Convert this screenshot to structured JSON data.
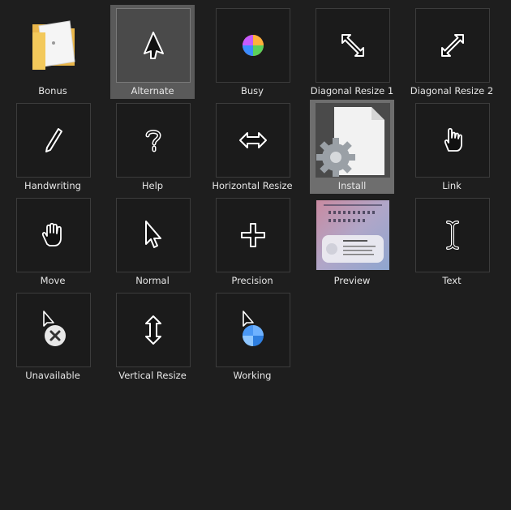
{
  "items": [
    {
      "label": "Bonus",
      "icon": "folder-icon"
    },
    {
      "label": "Alternate",
      "icon": "alternate-cursor-icon"
    },
    {
      "label": "Busy",
      "icon": "busy-cursor-icon"
    },
    {
      "label": "Diagonal Resize 1",
      "icon": "diagonal-resize-1-icon"
    },
    {
      "label": "Diagonal Resize 2",
      "icon": "diagonal-resize-2-icon"
    },
    {
      "label": "Handwriting",
      "icon": "handwriting-cursor-icon"
    },
    {
      "label": "Help",
      "icon": "help-cursor-icon"
    },
    {
      "label": "Horizontal Resize",
      "icon": "horizontal-resize-icon"
    },
    {
      "label": "Install",
      "icon": "install-file-icon"
    },
    {
      "label": "Link",
      "icon": "link-cursor-icon"
    },
    {
      "label": "Move",
      "icon": "move-cursor-icon"
    },
    {
      "label": "Normal",
      "icon": "normal-cursor-icon"
    },
    {
      "label": "Precision",
      "icon": "precision-cursor-icon"
    },
    {
      "label": "Preview",
      "icon": "preview-image-icon"
    },
    {
      "label": "Text",
      "icon": "text-cursor-icon"
    },
    {
      "label": "Unavailable",
      "icon": "unavailable-cursor-icon"
    },
    {
      "label": "Vertical Resize",
      "icon": "vertical-resize-icon"
    },
    {
      "label": "Working",
      "icon": "working-cursor-icon"
    }
  ],
  "colors": {
    "background": "#1e1e1e",
    "selected": "#5a5a5a",
    "tile_border": "#3c3c3c",
    "label": "#e6e6e6",
    "folder": "#f3c95b"
  }
}
